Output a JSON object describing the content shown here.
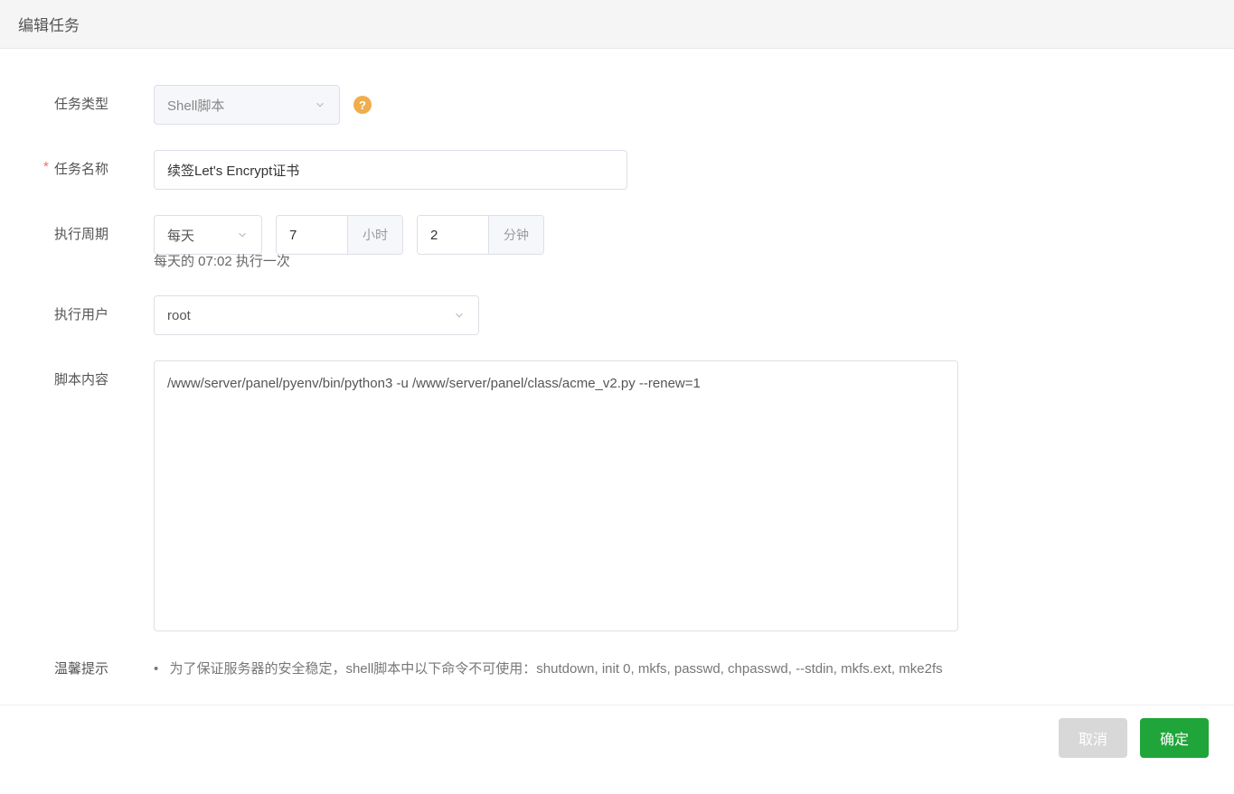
{
  "header": {
    "title": "编辑任务"
  },
  "form": {
    "task_type": {
      "label": "任务类型",
      "value": "Shell脚本"
    },
    "task_name": {
      "label": "任务名称",
      "value": "续签Let's Encrypt证书"
    },
    "cycle": {
      "label": "执行周期",
      "freq_value": "每天",
      "hour_value": "7",
      "hour_suffix": "小时",
      "minute_value": "2",
      "minute_suffix": "分钟",
      "hint": "每天的 07:02 执行一次"
    },
    "user": {
      "label": "执行用户",
      "value": "root"
    },
    "script": {
      "label": "脚本内容",
      "value": "/www/server/panel/pyenv/bin/python3 -u /www/server/panel/class/acme_v2.py --renew=1"
    },
    "tips": {
      "label": "温馨提示",
      "text": "为了保证服务器的安全稳定，shell脚本中以下命令不可使用：shutdown, init 0, mkfs, passwd, chpasswd, --stdin, mkfs.ext, mke2fs"
    }
  },
  "footer": {
    "cancel": "取消",
    "confirm": "确定"
  }
}
